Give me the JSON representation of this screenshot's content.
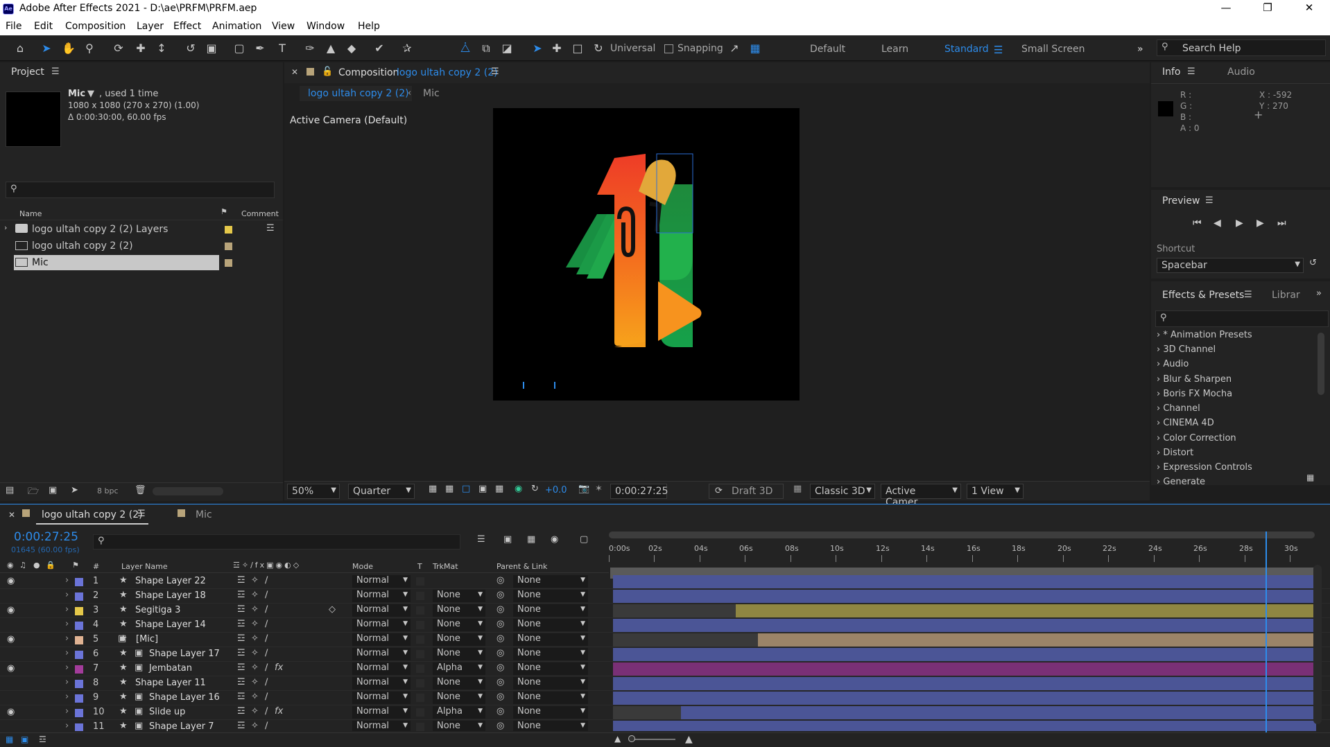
{
  "window": {
    "title": "Adobe After Effects 2021 - D:\\ae\\PRFM\\PRFM.aep",
    "app_icon": "Ae"
  },
  "menu": [
    "File",
    "Edit",
    "Composition",
    "Layer",
    "Effect",
    "Animation",
    "View",
    "Window",
    "Help"
  ],
  "toolbar": {
    "universal": "Universal",
    "snapping": "Snapping",
    "workspaces": [
      "Default",
      "Learn",
      "Standard",
      "Small Screen"
    ],
    "search_placeholder": "Search Help"
  },
  "project": {
    "title": "Project",
    "item_name": "Mic",
    "used": ", used 1 time",
    "dims": "1080 x 1080  (270 x 270) (1.00)",
    "duration": "Δ 0:00:30:00, 60.00 fps",
    "col_name": "Name",
    "col_comment": "Comment",
    "items": [
      {
        "name": "logo ultah copy 2 (2) Layers",
        "type": "folder",
        "color": "#e5c84a"
      },
      {
        "name": "logo ultah copy 2 (2)",
        "type": "comp",
        "color": "#b8a47a"
      },
      {
        "name": "Mic",
        "type": "comp",
        "color": "#b8a47a"
      }
    ],
    "bpc": "8 bpc"
  },
  "composition": {
    "label": "Composition",
    "name": "logo ultah copy 2 (2)",
    "tab_active": "logo ultah copy 2 (2)",
    "tab_other": "Mic",
    "camera": "Active Camera (Default)",
    "zoom": "50%",
    "resolution": "Quarter",
    "exposure": "+0.0",
    "timecode": "0:00:27:25",
    "renderer_btn": "Draft 3D",
    "renderer": "Classic 3D",
    "camera_view": "Active Camer...",
    "views": "1 View"
  },
  "info": {
    "tab": "Info",
    "tab2": "Audio",
    "r": "R :",
    "g": "G :",
    "b": "B :",
    "a": "A : 0",
    "x": "X : -592",
    "y": "Y : 270"
  },
  "preview": {
    "title": "Preview",
    "shortcut_label": "Shortcut",
    "shortcut": "Spacebar"
  },
  "effects": {
    "tab": "Effects & Presets",
    "tab2": "Librar",
    "items": [
      "* Animation Presets",
      "3D Channel",
      "Audio",
      "Blur & Sharpen",
      "Boris FX Mocha",
      "Channel",
      "CINEMA 4D",
      "Color Correction",
      "Distort",
      "Expression Controls",
      "Generate"
    ]
  },
  "timeline": {
    "tab": "logo ultah copy 2 (2)",
    "tab2": "Mic",
    "timecode": "0:00:27:25",
    "frames": "01645 (60.00 fps)",
    "headers": {
      "num": "#",
      "name": "Layer Name",
      "mode": "Mode",
      "t": "T",
      "trkmat": "TrkMat",
      "parent": "Parent & Link"
    },
    "ruler": [
      "0:00s",
      "02s",
      "04s",
      "06s",
      "08s",
      "10s",
      "12s",
      "14s",
      "16s",
      "18s",
      "20s",
      "22s",
      "24s",
      "26s",
      "28s",
      "30s"
    ],
    "playhead_fraction": 0.9283,
    "layers": [
      {
        "num": "1",
        "name": "Shape Layer 22",
        "kind": "star",
        "mode": "Normal",
        "trkmat": "",
        "parent": "None",
        "color": "#6b74d8",
        "eye": true,
        "fx": false,
        "bar_color": "#4b5596",
        "start": 0.0,
        "end": 1.0
      },
      {
        "num": "2",
        "name": "Shape Layer 18",
        "kind": "star",
        "mode": "Normal",
        "trkmat": "None",
        "parent": "None",
        "color": "#6b74d8",
        "eye": false,
        "fx": false,
        "bar_color": "#4b5596",
        "start": 0.0,
        "end": 1.0
      },
      {
        "num": "3",
        "name": "Segitiga 3",
        "kind": "star",
        "mode": "Normal",
        "trkmat": "None",
        "parent": "None",
        "color": "#e5c84a",
        "eye": true,
        "fx": false,
        "bar_color": "#8f8642",
        "start": 0.175,
        "end": 1.0
      },
      {
        "num": "4",
        "name": "Shape Layer 14",
        "kind": "star",
        "mode": "Normal",
        "trkmat": "None",
        "parent": "None",
        "color": "#6b74d8",
        "eye": false,
        "fx": false,
        "bar_color": "#4b5596",
        "start": 0.0,
        "end": 1.0
      },
      {
        "num": "5",
        "name": "[Mic]",
        "kind": "comp",
        "mode": "Normal",
        "trkmat": "None",
        "parent": "None",
        "color": "#e0b393",
        "eye": true,
        "fx": false,
        "bar_color": "#9b8468",
        "start": 0.206,
        "end": 1.0
      },
      {
        "num": "6",
        "name": "Shape Layer 17",
        "kind": "star-mask",
        "mode": "Normal",
        "trkmat": "None",
        "parent": "None",
        "color": "#6b74d8",
        "eye": false,
        "fx": false,
        "bar_color": "#4b5596",
        "start": 0.0,
        "end": 1.0
      },
      {
        "num": "7",
        "name": "Jembatan",
        "kind": "star-adj",
        "mode": "Normal",
        "trkmat": "Alpha",
        "parent": "None",
        "color": "#a33c9b",
        "eye": true,
        "fx": true,
        "bar_color": "#7a3076",
        "start": 0.0,
        "end": 1.0
      },
      {
        "num": "8",
        "name": "Shape Layer 11",
        "kind": "star",
        "mode": "Normal",
        "trkmat": "None",
        "parent": "None",
        "color": "#6b74d8",
        "eye": false,
        "fx": false,
        "bar_color": "#4b5596",
        "start": 0.0,
        "end": 1.0
      },
      {
        "num": "9",
        "name": "Shape Layer 16",
        "kind": "star-mask",
        "mode": "Normal",
        "trkmat": "None",
        "parent": "None",
        "color": "#6b74d8",
        "eye": false,
        "fx": false,
        "bar_color": "#4b5596",
        "start": 0.0,
        "end": 1.0
      },
      {
        "num": "10",
        "name": "Slide up",
        "kind": "star-adj",
        "mode": "Normal",
        "trkmat": "Alpha",
        "parent": "None",
        "color": "#6b74d8",
        "eye": true,
        "fx": true,
        "bar_color": "#4b5596",
        "start": 0.097,
        "end": 1.0
      },
      {
        "num": "11",
        "name": "Shape Layer 7",
        "kind": "star-mask",
        "mode": "Normal",
        "trkmat": "None",
        "parent": "None",
        "color": "#6b74d8",
        "eye": false,
        "fx": false,
        "bar_color": "#4b5596",
        "start": 0.0,
        "end": 1.0
      }
    ]
  },
  "colors": {
    "accent": "#2d8ceb",
    "panel": "#232323",
    "bg": "#1d1d1d"
  }
}
